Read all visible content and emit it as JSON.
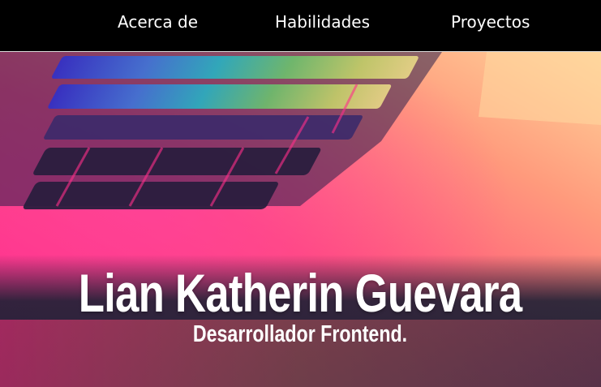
{
  "nav": {
    "items": [
      {
        "label": "Acerca de"
      },
      {
        "label": "Habilidades"
      },
      {
        "label": "Proyectos"
      }
    ]
  },
  "hero": {
    "name": "Lian Katherin Guevara",
    "tagline": "Desarrollador Frontend.",
    "background_image": "laptop-keyboard-rainbow-photo"
  },
  "colors": {
    "nav_background": "#000000",
    "nav_text": "#ffffff",
    "hero_text": "#ffffff",
    "hero_dark": "#1c2134",
    "hero_pink": "#ff2f8a",
    "hero_peach": "#ffb585"
  }
}
